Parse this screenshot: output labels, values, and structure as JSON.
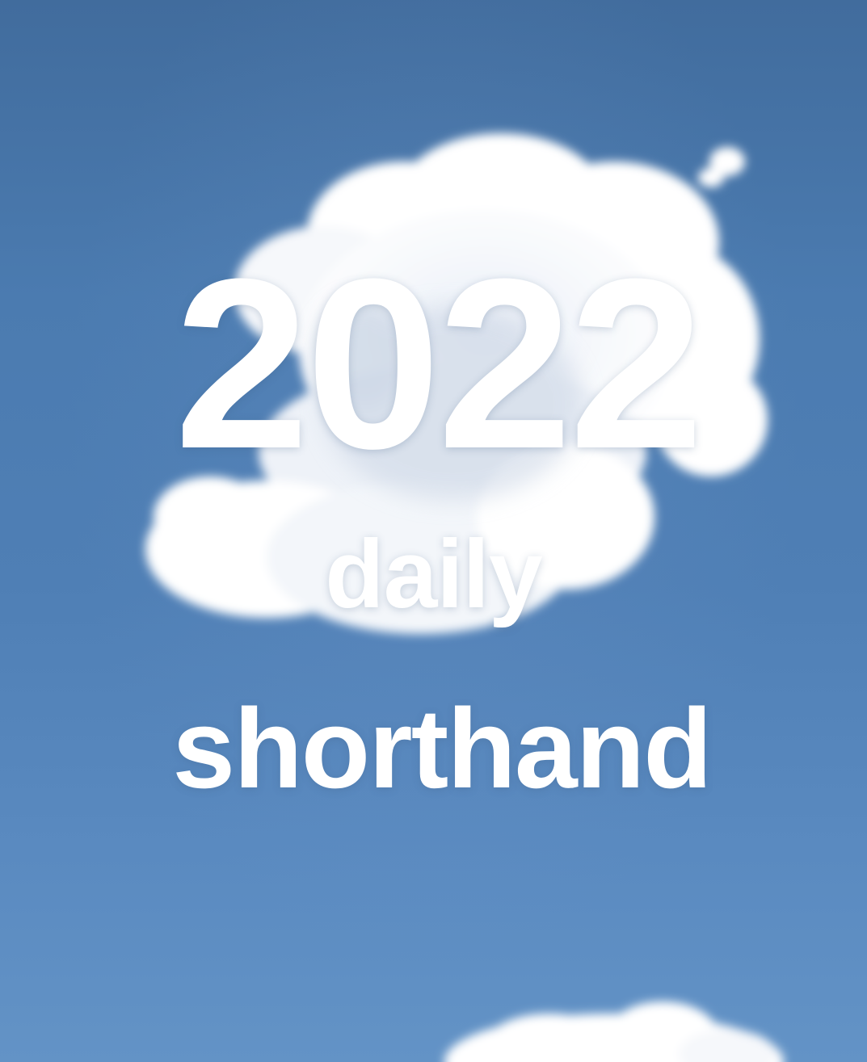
{
  "image": {
    "sky_color_top": "#416c9d",
    "sky_color_bottom": "#6393c6",
    "cloud_color": "#ffffff",
    "text_color": "#ffffff"
  },
  "overlay": {
    "year": "2022",
    "line2": "daily",
    "line3": "shorthand"
  }
}
